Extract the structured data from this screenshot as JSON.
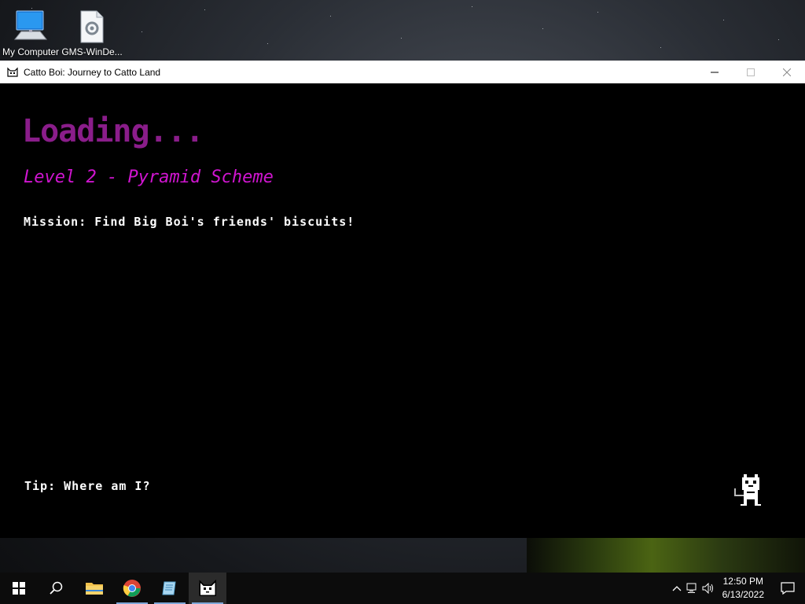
{
  "desktop": {
    "icons": [
      {
        "label": "My Computer"
      },
      {
        "label": "GMS-WinDe..."
      }
    ]
  },
  "window": {
    "title": "Catto Boi: Journey to Catto Land"
  },
  "game": {
    "loading_text": "Loading...",
    "level_text": "Level 2 - Pyramid Scheme",
    "mission_text": "Mission: Find Big Boi's friends' biscuits!",
    "tip_text": "Tip: Where am I?"
  },
  "taskbar": {
    "apps": [
      "start-icon",
      "search-icon",
      "file-explorer-icon",
      "chrome-icon",
      "notepad-icon",
      "catto-boi-icon"
    ],
    "clock_time": "12:50 PM",
    "clock_date": "6/13/2022"
  },
  "colors": {
    "loading": "#8a1d8a",
    "level": "#d015d0",
    "game_bg": "#000000",
    "taskbar_bg": "#0c0c0c"
  }
}
